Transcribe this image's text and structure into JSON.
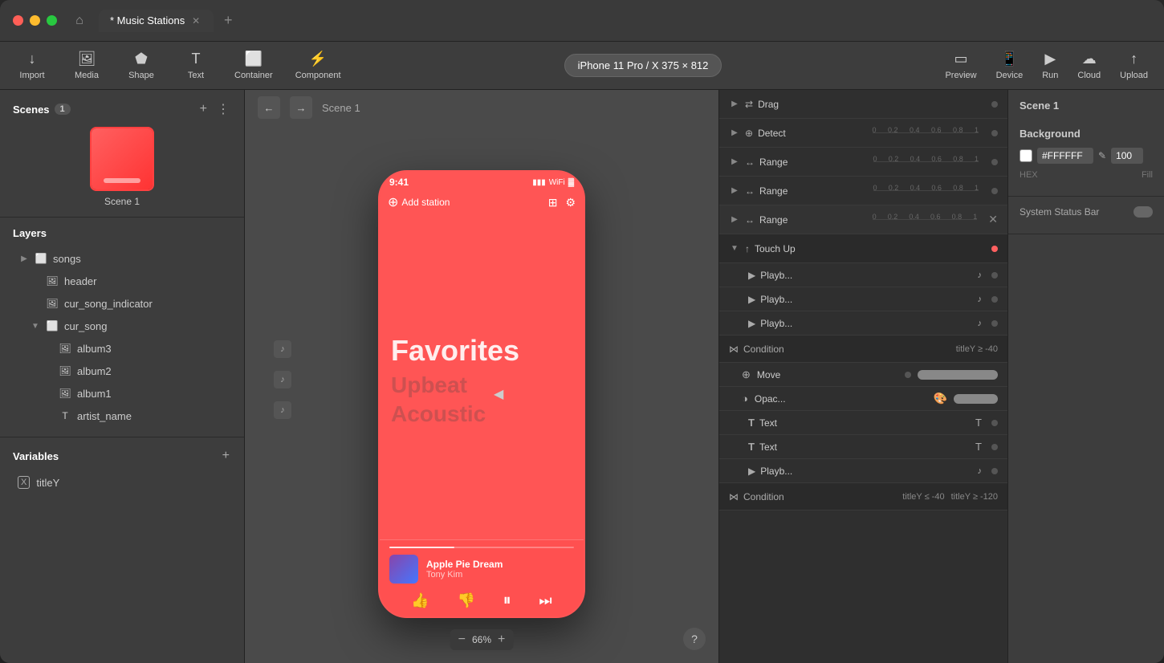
{
  "window": {
    "title": "Music Stations",
    "tab_label": "* Music Stations",
    "modified": true
  },
  "toolbar": {
    "import_label": "Import",
    "media_label": "Media",
    "shape_label": "Shape",
    "text_label": "Text",
    "container_label": "Container",
    "component_label": "Component",
    "device_selector": "iPhone 11 Pro / X  375 × 812",
    "preview_label": "Preview",
    "device_label": "Device",
    "run_label": "Run",
    "cloud_label": "Cloud",
    "upload_label": "Upload"
  },
  "sidebar": {
    "scenes_title": "Scenes",
    "scenes_count": "1",
    "scene_name": "Scene 1",
    "layers_title": "Layers",
    "layers": [
      {
        "id": "songs",
        "label": "songs",
        "indent": 0,
        "type": "group",
        "expand": true
      },
      {
        "id": "header",
        "label": "header",
        "indent": 1,
        "type": "image"
      },
      {
        "id": "cur_song_indicator",
        "label": "cur_song_indicator",
        "indent": 1,
        "type": "image"
      },
      {
        "id": "cur_song",
        "label": "cur_song",
        "indent": 1,
        "type": "group",
        "expand": true
      },
      {
        "id": "album3",
        "label": "album3",
        "indent": 2,
        "type": "image"
      },
      {
        "id": "album2",
        "label": "album2",
        "indent": 2,
        "type": "image"
      },
      {
        "id": "album1",
        "label": "album1",
        "indent": 2,
        "type": "image"
      },
      {
        "id": "artist_name",
        "label": "artist_name",
        "indent": 2,
        "type": "text"
      }
    ],
    "variables_title": "Variables",
    "variables": [
      {
        "id": "titleY",
        "label": "titleY"
      }
    ]
  },
  "canvas": {
    "scene_label": "Scene 1",
    "zoom": "66%"
  },
  "phone": {
    "status_time": "9:41",
    "add_station": "Add station",
    "favorites": "Favorites",
    "genre1": "Upbeat",
    "genre2": "Acoustic",
    "track_title": "Apple Pie Dream",
    "track_artist": "Tony Kim"
  },
  "interactions": {
    "drag_label": "Drag",
    "detect_label": "Detect",
    "range_labels": [
      "Range",
      "Range",
      "Range"
    ],
    "touch_up_label": "Touch Up",
    "playback_labels": [
      "Playb...",
      "Playb...",
      "Playb..."
    ],
    "condition_label": "Condition",
    "move_label": "Move",
    "opacity_label": "Opac...",
    "text_labels": [
      "Text",
      "Text"
    ],
    "condition2_label": "Condition",
    "condition_val1": "titleY ≥ -40",
    "condition_val2": "titleY ≤ -40",
    "condition_val3": "titleY ≥ -120",
    "range_values": [
      "0",
      "0.2",
      "0.4",
      "0.6",
      "0.8",
      "1"
    ]
  },
  "properties": {
    "scene_label": "Scene 1",
    "background_label": "Background",
    "hex_value": "#FFFFFF",
    "opacity_value": "100",
    "hex_label": "HEX",
    "fill_label": "Fill",
    "system_status_bar": "System Status Bar"
  }
}
